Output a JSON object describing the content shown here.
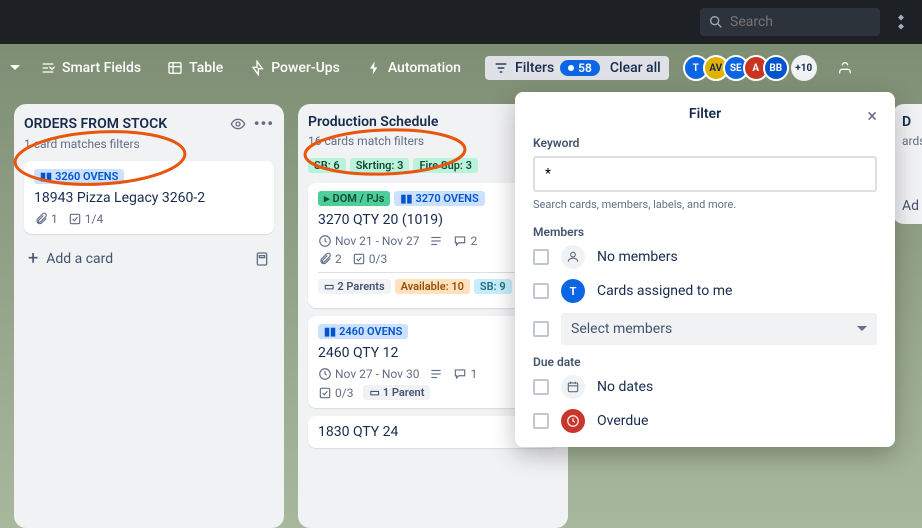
{
  "topbar": {
    "search_placeholder": "Search"
  },
  "toolbar": {
    "smart_fields": "Smart Fields",
    "table": "Table",
    "powerups": "Power-Ups",
    "automation": "Automation",
    "filters": "Filters",
    "filter_count": "58",
    "clear_all": "Clear all",
    "avatars": [
      "T",
      "AV",
      "SE",
      "A",
      "BB"
    ],
    "avatar_more": "+10"
  },
  "lists": {
    "stock": {
      "title": "ORDERS FROM STOCK",
      "subtitle": "1 card matches filters",
      "card1": {
        "label": "3260 OVENS",
        "title": "18943 Pizza Legacy 3260-2",
        "attach": "1",
        "checklist": "1/4"
      },
      "add_card": "Add a card"
    },
    "prod": {
      "title": "Production Schedule",
      "subtitle": "16 cards match filters",
      "summary": {
        "sb": "SB: 6",
        "skrting": "Skrting: 3",
        "firesup": "Fire Sup: 3"
      },
      "card1": {
        "lbl_dom": "DOM / PJs",
        "lbl_ovens": "3270 OVENS",
        "title": "3270 QTY 20 (1019)",
        "date": "Nov 21 - Nov 27",
        "comments": "2",
        "attach": "2",
        "checklist": "0/3",
        "parents": "2 Parents",
        "available": "Available: 10",
        "sb": "SB: 9"
      },
      "card2": {
        "lbl_ovens": "2460 OVENS",
        "title": "2460 QTY 12",
        "date": "Nov 27 - Nov 30",
        "comments": "1",
        "checklist": "0/3",
        "parents": "1 Parent"
      },
      "card3_title": "1830 QTY 24"
    },
    "right": {
      "title_partial": "D",
      "subtitle_partial": "ards",
      "add_partial": "Ad"
    }
  },
  "filter_panel": {
    "title": "Filter",
    "keyword_label": "Keyword",
    "keyword_value": "*",
    "keyword_help": "Search cards, members, labels, and more.",
    "members_label": "Members",
    "no_members": "No members",
    "assigned_me": "Cards assigned to me",
    "me_initial": "T",
    "select_members": "Select members",
    "due_label": "Due date",
    "no_dates": "No dates",
    "overdue": "Overdue"
  }
}
